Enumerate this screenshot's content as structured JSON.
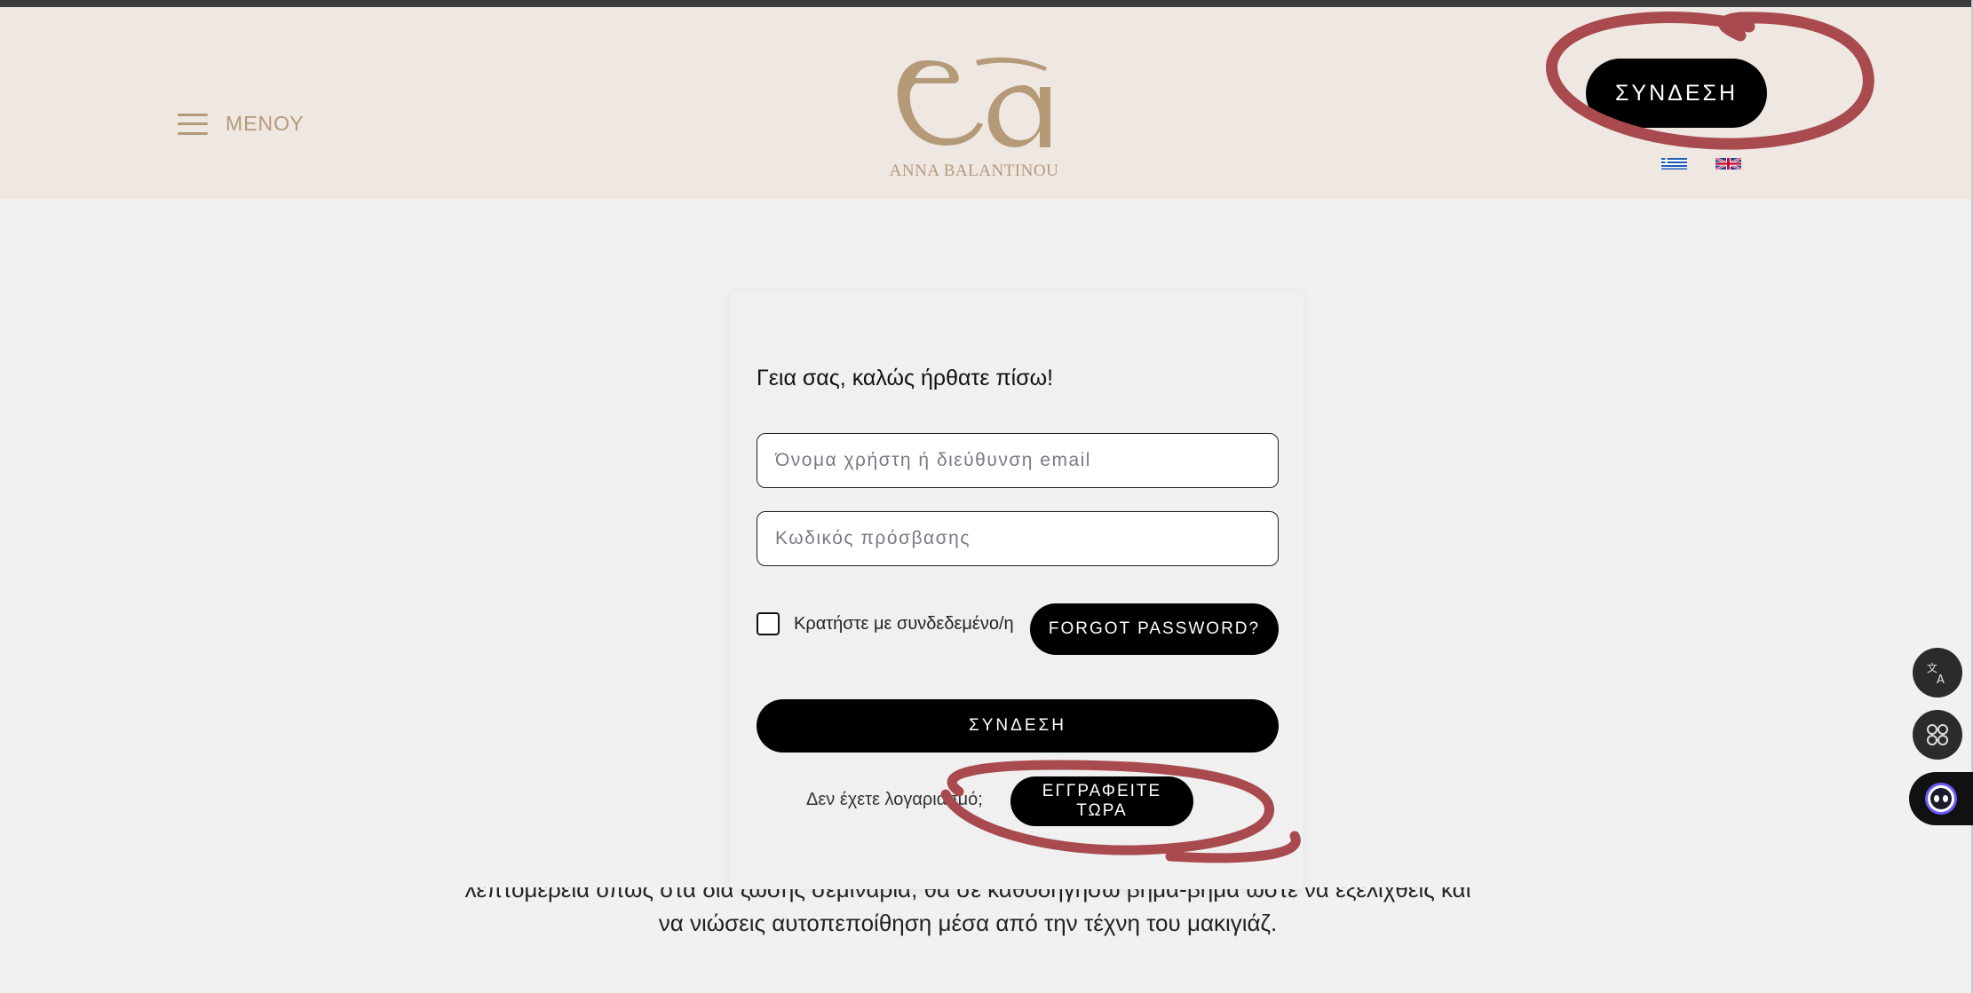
{
  "header": {
    "menu_label": "ΜΕΝΟΥ",
    "logo_monogram": "ea",
    "logo_text": "ANNA BALANTINOU",
    "login_button": "ΣΥΝΔΕΣΗ",
    "languages": [
      "greek-flag-icon",
      "uk-flag-icon"
    ]
  },
  "login_card": {
    "greeting": "Γεια σας, καλώς ήρθατε πίσω!",
    "username_placeholder": "Όνομα χρήστη ή διεύθυνση email",
    "username_value": "",
    "password_placeholder": "Κωδικός πρόσβασης",
    "password_value": "",
    "remember_label": "Κρατήστε με συνδεδεμένο/η",
    "remember_checked": false,
    "forgot_button": "FORGOT PASSWORD?",
    "submit_button": "ΣΥΝΔΕΣΗ",
    "no_account_text": "Δεν έχετε λογαριασμό;",
    "register_button": "ΕΓΓΡΑΦΕΙΤΕ ΤΩΡΑ"
  },
  "body": {
    "line1": "λεπτομέρεια όπως στα δια ζώσης σεμινάρια, θα σε καθοδηγήσω βήμα-βήμα ώστε να εξελιχθείς και",
    "line2": "να νιώσεις αυτοπεποίθηση μέσα από την τέχνη του μακιγιάζ."
  },
  "side_widgets": [
    "translate-icon",
    "apps-grid-icon",
    "assistant-bot-icon"
  ],
  "colors": {
    "header_bg": "#efe7e2",
    "page_bg": "#f1f1f1",
    "brand_gold": "#b59a78",
    "button_black": "#000000",
    "annotation_red": "#a84a4e"
  }
}
